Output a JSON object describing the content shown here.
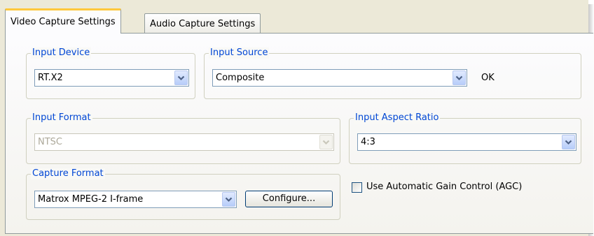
{
  "tabs": [
    {
      "label": "Video Capture Settings",
      "active": true
    },
    {
      "label": "Audio Capture Settings",
      "active": false
    }
  ],
  "input_device": {
    "title": "Input Device",
    "value": "RT.X2"
  },
  "input_source": {
    "title": "Input Source",
    "value": "Composite",
    "status": "OK"
  },
  "input_format": {
    "title": "Input Format",
    "value": "NTSC",
    "disabled": true
  },
  "input_aspect_ratio": {
    "title": "Input Aspect Ratio",
    "value": "4:3"
  },
  "capture_format": {
    "title": "Capture Format",
    "value": "Matrox MPEG-2 I-frame",
    "configure_label": "Configure..."
  },
  "agc": {
    "label": "Use Automatic Gain Control (AGC)",
    "checked": false
  },
  "colors": {
    "group_title": "#0046d5",
    "tab_highlight": "#ffc83c",
    "dialog_background": "#ece9d8",
    "disabled_text": "#aca899"
  },
  "icons": {
    "dropdown": "chevron-down-icon",
    "dropdown_disabled": "chevron-down-icon"
  }
}
